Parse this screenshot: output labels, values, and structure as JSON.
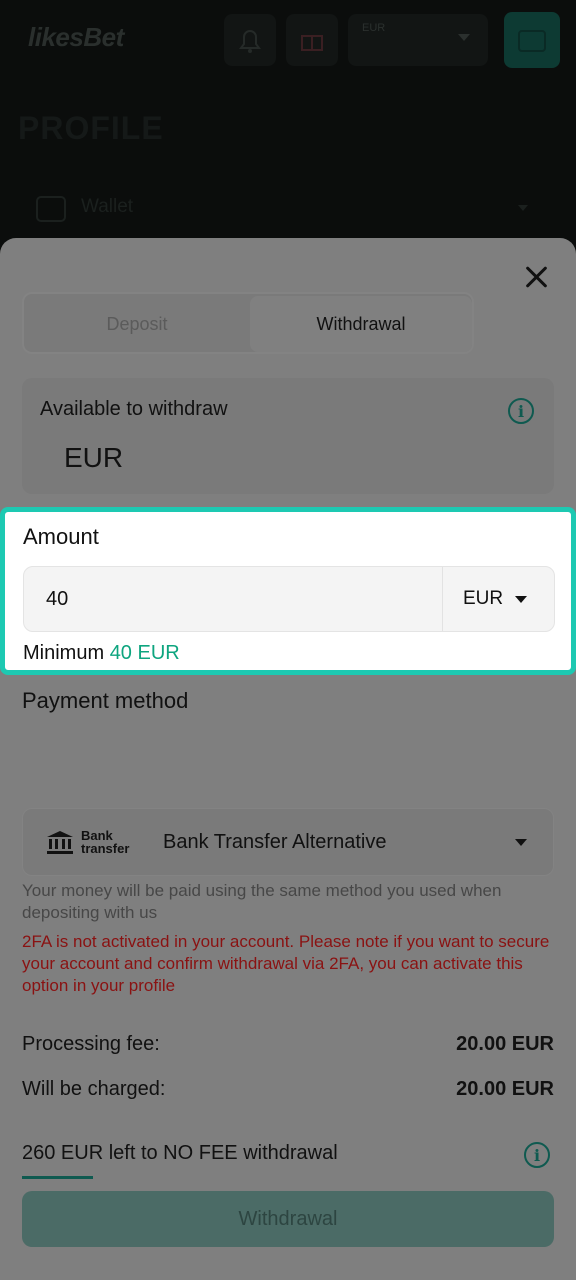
{
  "header": {
    "logo_text": "likesBet",
    "currency_label": "EUR"
  },
  "profile": {
    "title": "PROFILE",
    "wallet_label": "Wallet"
  },
  "tabs": [
    {
      "label": "Deposit",
      "active": false
    },
    {
      "label": "Withdrawal",
      "active": true
    }
  ],
  "available": {
    "label": "Available to withdraw",
    "currency": "EUR"
  },
  "amount": {
    "label": "Amount",
    "value": "40",
    "currency": "EUR",
    "minimum_label": "Minimum",
    "minimum_value": "40 EUR"
  },
  "payment": {
    "title": "Payment method",
    "logo_line1": "Bank",
    "logo_line2": "transfer",
    "selected": "Bank Transfer Alternative",
    "note": "Your money will be paid using the same method you used when depositing with us",
    "warning": "2FA is not activated in your account. Please note if you want to secure your account and confirm withdrawal via 2FA, you can activate this option in your profile"
  },
  "fees": {
    "processing_label": "Processing fee:",
    "processing_value": "20.00 EUR",
    "charged_label": "Will be charged:",
    "charged_value": "20.00 EUR"
  },
  "nofee": {
    "text": "260 EUR left to NO FEE withdrawal",
    "progress_fraction": 0.133
  },
  "actions": {
    "withdraw_label": "Withdrawal"
  },
  "colors": {
    "highlight_border": "#1dc9b2",
    "accent_green": "#0ea57f",
    "warning_red": "#8a1212"
  }
}
